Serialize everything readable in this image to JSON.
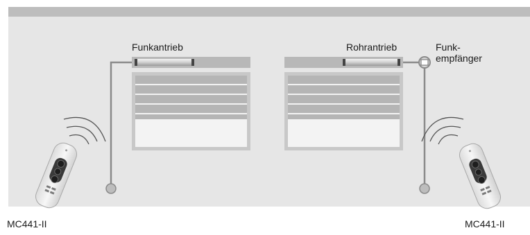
{
  "labels": {
    "left_motor": "Funkantrieb",
    "right_motor": "Rohrantrieb",
    "receiver_line1": "Funk-",
    "receiver_line2": "empfänger",
    "left_remote": "MC441-II",
    "right_remote": "MC441-II"
  },
  "colors": {
    "background_panel": "#e6e6e6",
    "top_band": "#bdbdbd",
    "window_frame": "#c8c8c8",
    "shutter_slat": "#b5b5b5",
    "cable": "#8a8a8a",
    "remote_body": "#efefef",
    "remote_keypad": "#3a3a3a"
  },
  "shutter": {
    "closed_fraction": 0.5
  }
}
